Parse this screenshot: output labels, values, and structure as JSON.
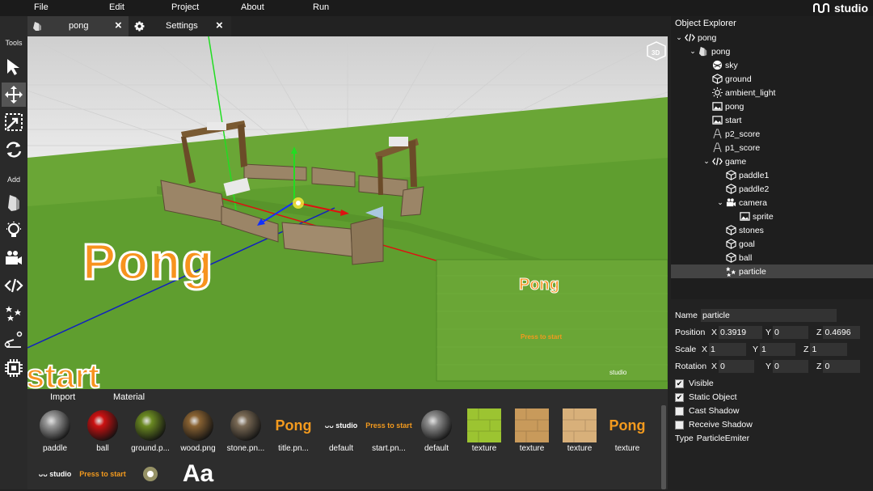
{
  "menu": [
    "File",
    "Edit",
    "Project",
    "About",
    "Run"
  ],
  "logo_text": "studio",
  "toolbar": {
    "tools_label": "Tools",
    "add_label": "Add"
  },
  "tabs": [
    {
      "label": "pong"
    },
    {
      "label": "Settings"
    }
  ],
  "viewport": {
    "overlay_title": "Pong",
    "overlay_start": "start",
    "preview_title": "Pong",
    "preview_prompt": "Press to start",
    "preview_logo": "studio"
  },
  "bottom": {
    "tabs": [
      "Import",
      "Material"
    ],
    "assets": [
      {
        "label": "paddle",
        "kind": "sphere",
        "color": "#9a9a9a"
      },
      {
        "label": "ball",
        "kind": "sphere",
        "color": "#cc1111"
      },
      {
        "label": "ground.p...",
        "kind": "sphere",
        "color": "#6b8a22"
      },
      {
        "label": "wood.png",
        "kind": "sphere",
        "color": "#8a6333"
      },
      {
        "label": "stone.pn...",
        "kind": "sphere",
        "color": "#7a6a55"
      },
      {
        "label": "title.pn...",
        "kind": "text",
        "text": "Pong",
        "color": "#f39a1e"
      },
      {
        "label": "default",
        "kind": "text",
        "text": "ᴗᴗ studio",
        "color": "#ffffff"
      },
      {
        "label": "start.pn...",
        "kind": "text",
        "text": "Press to start",
        "color": "#f39a1e"
      },
      {
        "label": "default",
        "kind": "sphere",
        "color": "#8f8f8f"
      },
      {
        "label": "texture",
        "kind": "swatch",
        "color": "#9cc431"
      },
      {
        "label": "texture",
        "kind": "swatch",
        "color": "#c89a5b"
      },
      {
        "label": "texture",
        "kind": "swatch",
        "color": "#d8b07a"
      },
      {
        "label": "texture",
        "kind": "text",
        "text": "Pong",
        "color": "#f39a1e"
      }
    ],
    "row2": [
      {
        "kind": "text",
        "text": "ᴗᴗ studio",
        "color": "#ffffff"
      },
      {
        "kind": "text",
        "text": "Press to start",
        "color": "#f39a1e"
      },
      {
        "kind": "glow",
        "color": "#fff7a0"
      },
      {
        "kind": "font",
        "text": "Aa",
        "color": "#ffffff"
      }
    ]
  },
  "explorer": {
    "title": "Object Explorer",
    "items": [
      {
        "label": "pong",
        "depth": 0,
        "chev": "⌄",
        "icon": "code-icon"
      },
      {
        "label": "pong",
        "depth": 1,
        "chev": "⌄",
        "icon": "scene-icon"
      },
      {
        "label": "sky",
        "depth": 2,
        "chev": "",
        "icon": "sky-icon"
      },
      {
        "label": "ground",
        "depth": 2,
        "chev": "",
        "icon": "cube-icon"
      },
      {
        "label": "ambient_light",
        "depth": 2,
        "chev": "",
        "icon": "light-icon"
      },
      {
        "label": "pong",
        "depth": 2,
        "chev": "",
        "icon": "image-icon"
      },
      {
        "label": "start",
        "depth": 2,
        "chev": "",
        "icon": "image-icon"
      },
      {
        "label": "p2_score",
        "depth": 2,
        "chev": "",
        "icon": "text-icon"
      },
      {
        "label": "p1_score",
        "depth": 2,
        "chev": "",
        "icon": "text-icon"
      },
      {
        "label": "game",
        "depth": 2,
        "chev": "⌄",
        "icon": "code-icon"
      },
      {
        "label": "paddle1",
        "depth": 3,
        "chev": "",
        "icon": "cube-icon"
      },
      {
        "label": "paddle2",
        "depth": 3,
        "chev": "",
        "icon": "cube-icon"
      },
      {
        "label": "camera",
        "depth": 3,
        "chev": "⌄",
        "icon": "camera-icon"
      },
      {
        "label": "sprite",
        "depth": 4,
        "chev": "",
        "icon": "image-icon"
      },
      {
        "label": "stones",
        "depth": 3,
        "chev": "",
        "icon": "cube-icon"
      },
      {
        "label": "goal",
        "depth": 3,
        "chev": "",
        "icon": "cube-icon"
      },
      {
        "label": "ball",
        "depth": 3,
        "chev": "",
        "icon": "cube-icon"
      },
      {
        "label": "particle",
        "depth": 3,
        "chev": "",
        "icon": "particle-icon",
        "selected": true
      }
    ]
  },
  "properties": {
    "name_label": "Name",
    "name_value": "particle",
    "position_label": "Position",
    "position": {
      "x": "0.3919",
      "y": "0",
      "z": "0.4696"
    },
    "scale_label": "Scale",
    "scale": {
      "x": "1",
      "y": "1",
      "z": "1"
    },
    "rotation_label": "Rotation",
    "rotation": {
      "x": "0",
      "y": "0",
      "z": "0"
    },
    "axis_x": "X",
    "axis_y": "Y",
    "axis_z": "Z",
    "visible_label": "Visible",
    "visible": true,
    "static_label": "Static Object",
    "static": true,
    "cast_label": "Cast Shadow",
    "cast": false,
    "receive_label": "Receive Shadow",
    "receive": false,
    "type_label": "Type",
    "type_value": "ParticleEmiter"
  }
}
